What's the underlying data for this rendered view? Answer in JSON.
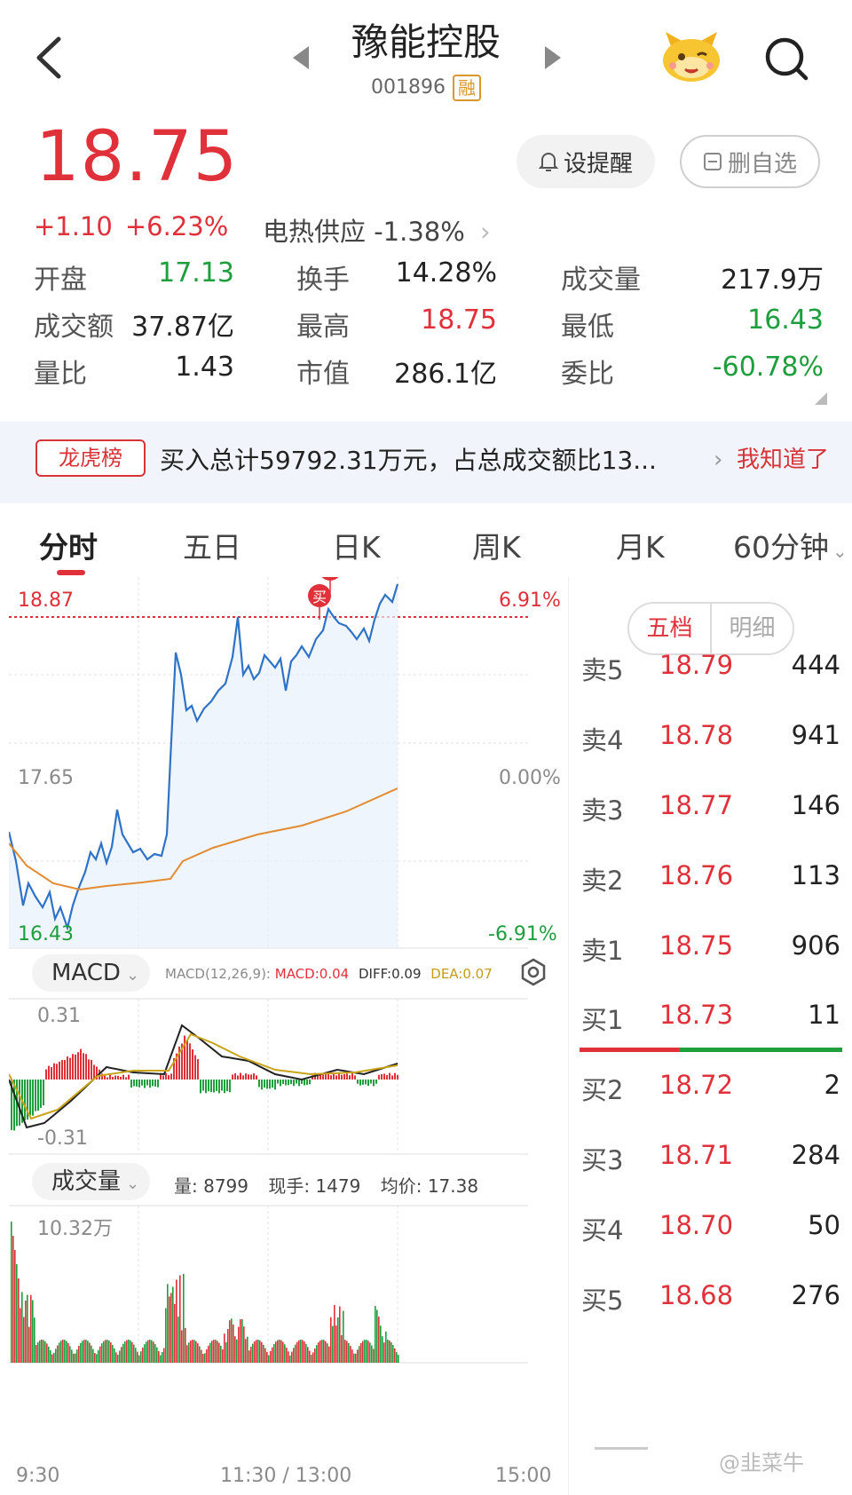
{
  "header": {
    "title": "豫能控股",
    "code": "001896",
    "margin_tag": "融"
  },
  "quote": {
    "price": "18.75",
    "change": "+1.10",
    "change_pct": "+6.23%",
    "sector": "电热供应 -1.38%",
    "alert_label": "设提醒",
    "remove_label": "删自选",
    "stats": [
      [
        {
          "label": "开盘",
          "value": "17.13",
          "color": "green"
        },
        {
          "label": "换手",
          "value": "14.28%",
          "color": "dark"
        },
        {
          "label": "成交量",
          "value": "217.9万",
          "color": "dark"
        }
      ],
      [
        {
          "label": "成交额",
          "value": "37.87亿",
          "color": "dark"
        },
        {
          "label": "最高",
          "value": "18.75",
          "color": "red"
        },
        {
          "label": "最低",
          "value": "16.43",
          "color": "green"
        }
      ],
      [
        {
          "label": "量比",
          "value": "1.43",
          "color": "dark"
        },
        {
          "label": "市值",
          "value": "286.1亿",
          "color": "dark"
        },
        {
          "label": "委比",
          "value": "-60.78%",
          "color": "green"
        }
      ]
    ]
  },
  "banner": {
    "tag": "龙虎榜",
    "text": "买入总计59792.31万元，占总成交额比13...",
    "ack": "我知道了"
  },
  "tabs": [
    "分时",
    "五日",
    "日K",
    "周K",
    "月K",
    "60分钟"
  ],
  "chart": {
    "price_high": "18.87",
    "price_mid": "17.65",
    "price_low": "16.43",
    "pct_high": "6.91%",
    "pct_mid": "0.00%",
    "pct_low": "-6.91%",
    "buy_marker": "买",
    "macd_label": "MACD",
    "macd_params": "MACD(12,26,9):",
    "macd_value": "MACD:0.04",
    "diff_value": "DIFF:0.09",
    "dea_value": "DEA:0.07",
    "macd_high": "0.31",
    "macd_low": "-0.31",
    "vol_label": "成交量",
    "vol_amount": "量: 8799",
    "vol_current": "现手: 1479",
    "vol_avg": "均价: 17.38",
    "vol_max": "10.32万",
    "time_start": "9:30",
    "time_mid": "11:30 / 13:00",
    "time_end": "15:00"
  },
  "orderbook": {
    "tab_on": "五档",
    "tab_off": "明细",
    "sells": [
      {
        "k": "卖5",
        "p": "18.79",
        "v": "444"
      },
      {
        "k": "卖4",
        "p": "18.78",
        "v": "941"
      },
      {
        "k": "卖3",
        "p": "18.77",
        "v": "146"
      },
      {
        "k": "卖2",
        "p": "18.76",
        "v": "113"
      },
      {
        "k": "卖1",
        "p": "18.75",
        "v": "906"
      }
    ],
    "buys": [
      {
        "k": "买1",
        "p": "18.73",
        "v": "11"
      },
      {
        "k": "买2",
        "p": "18.72",
        "v": "2"
      },
      {
        "k": "买3",
        "p": "18.71",
        "v": "284"
      },
      {
        "k": "买4",
        "p": "18.70",
        "v": "50"
      },
      {
        "k": "买5",
        "p": "18.68",
        "v": "276"
      }
    ]
  },
  "watermark": "@韭菜牛"
}
